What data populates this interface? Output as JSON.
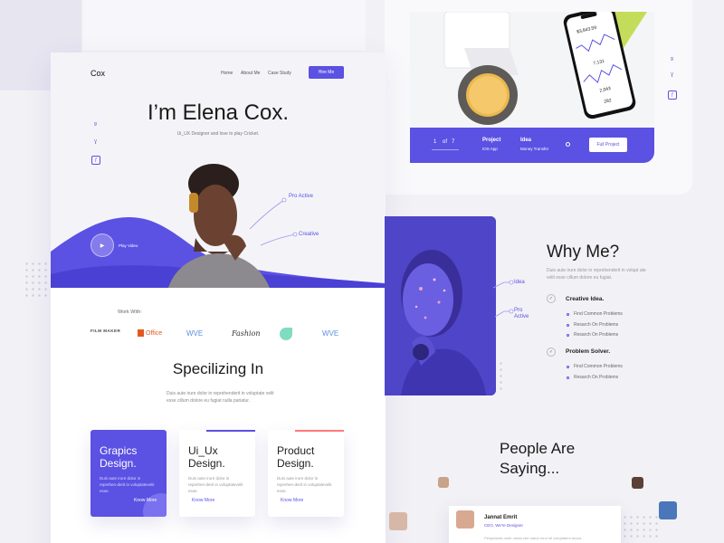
{
  "header": {
    "logo": "Cox",
    "nav": [
      "Home",
      "About Me",
      "Case Study"
    ],
    "cta": "Hire Me"
  },
  "hero": {
    "title": "I’m Elena Cox.",
    "subtitle": "Ui_UX Designer and love to play Cricket.",
    "play_label": "Play Video",
    "tags": [
      "Pro Active",
      "Creative"
    ]
  },
  "social": {
    "left": [
      "ǥ",
      "Ɣ",
      "ƒ"
    ],
    "right": [
      "ǥ",
      "Ɣ",
      "ƒ"
    ]
  },
  "work": {
    "label": "Work With:",
    "brands": [
      "FILM MAKER",
      "Office",
      "WVE",
      "Fashion",
      "WVE"
    ]
  },
  "specializing": {
    "title": "Specilizing In",
    "description": "Duis aute irure dolor in reprehenderit in voluptate velit esse cillum dolore eu fugiat nulla pariatur.",
    "cards": [
      {
        "title": "Grapics Design.",
        "desc": "Duis aute irure dolor in reprehen-derit in voluptatevelit esse.",
        "link": "Know More"
      },
      {
        "title": "Ui_Ux Design.",
        "desc": "Duis aute irure dolor in reprehen-derit in voluptatevelit esse.",
        "link": "Know More"
      },
      {
        "title": "Product Design.",
        "desc": "Duis aute irure dolor in reprehen-derit in voluptatevelit esse.",
        "link": "Know More"
      }
    ]
  },
  "project": {
    "pager_current": "1",
    "pager_of": "of",
    "pager_total": "7",
    "project_label": "Project",
    "project_value": "IOS App",
    "idea_label": "Idea",
    "idea_value": "Money Transfer",
    "button": "Full Project",
    "phone_values": [
      "$3,843.59",
      "7,131",
      "2,043",
      "282"
    ]
  },
  "why": {
    "title": "Why Me?",
    "description": "Duis aute irure dolor in reprehenderit in volupt ate velit esse cillum dolore eu fugiat.",
    "tags": [
      "Idea",
      "Pro Active"
    ],
    "groups": [
      {
        "title": "Creative Idea.",
        "items": [
          "Find Common Problems",
          "Resarch On Problems",
          "Resarch On Problems"
        ]
      },
      {
        "title": "Problem Solver.",
        "items": [
          "Find Common Problems",
          "Resarch On Problems"
        ]
      }
    ]
  },
  "testimonials": {
    "title_line1": "People Are",
    "title_line2": "Saying...",
    "name": "Jannat Emrit",
    "role": "CEO, We're Designer",
    "text": "Perspiciatis unde omnis iste natus error sit voluptatem accus."
  },
  "colors": {
    "accent": "#5b51e3",
    "accent_light": "#7a71f0",
    "coral": "#ff7a7a",
    "background": "#f2f1f5"
  }
}
